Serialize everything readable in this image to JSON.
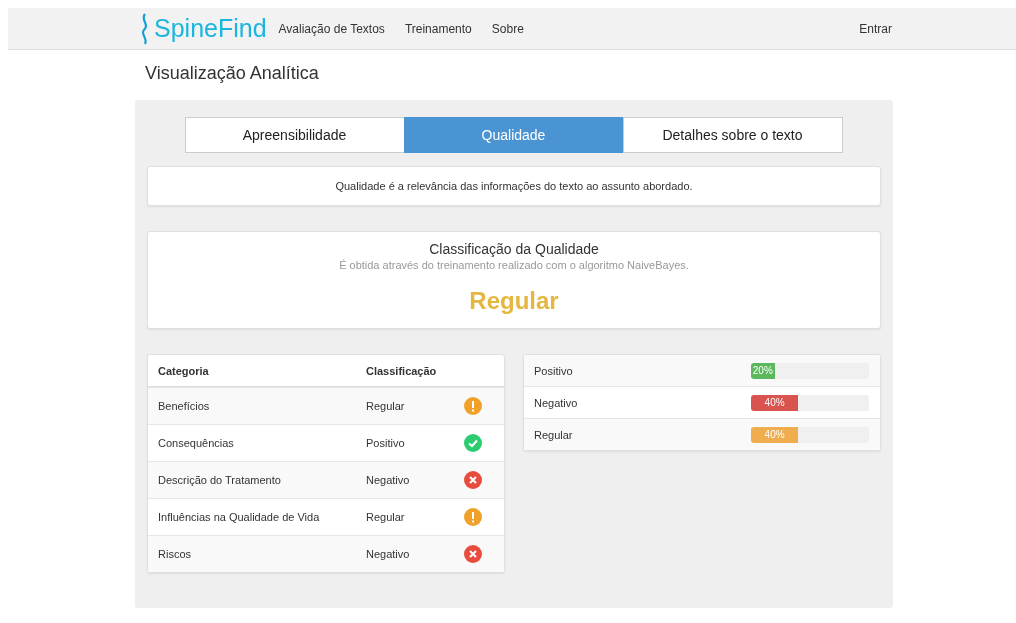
{
  "navbar": {
    "brand": "SpineFind",
    "links": [
      "Avaliação de Textos",
      "Treinamento",
      "Sobre"
    ],
    "login": "Entrar"
  },
  "page_title": "Visualização Analítica",
  "tabs": [
    {
      "label": "Apreensibilidade",
      "selected": false
    },
    {
      "label": "Qualidade",
      "selected": true
    },
    {
      "label": "Detalhes sobre o texto",
      "selected": false
    }
  ],
  "description": "Qualidade é a relevância das informações do texto ao assunto abordado.",
  "classification": {
    "title": "Classificação da Qualidade",
    "subtitle": "É obtida através do treinamento realizado com o algoritmo NaiveBayes.",
    "result": "Regular"
  },
  "table": {
    "columns": [
      "Categoria",
      "Classificação"
    ],
    "rows": [
      {
        "category": "Benefícios",
        "classification": "Regular",
        "kind": "warning"
      },
      {
        "category": "Consequências",
        "classification": "Positivo",
        "kind": "success"
      },
      {
        "category": "Descrição do Tratamento",
        "classification": "Negativo",
        "kind": "error"
      },
      {
        "category": "Influências na Qualidade de Vida",
        "classification": "Regular",
        "kind": "warning"
      },
      {
        "category": "Riscos",
        "classification": "Negativo",
        "kind": "error"
      }
    ]
  },
  "bars": [
    {
      "label": "Positivo",
      "level": 0.2,
      "reading": "20%",
      "color": "#5cb85c"
    },
    {
      "label": "Negativo",
      "level": 0.4,
      "reading": "40%",
      "color": "#d9534f"
    },
    {
      "label": "Regular",
      "level": 0.4,
      "reading": "40%",
      "color": "#f0ad4e"
    }
  ]
}
